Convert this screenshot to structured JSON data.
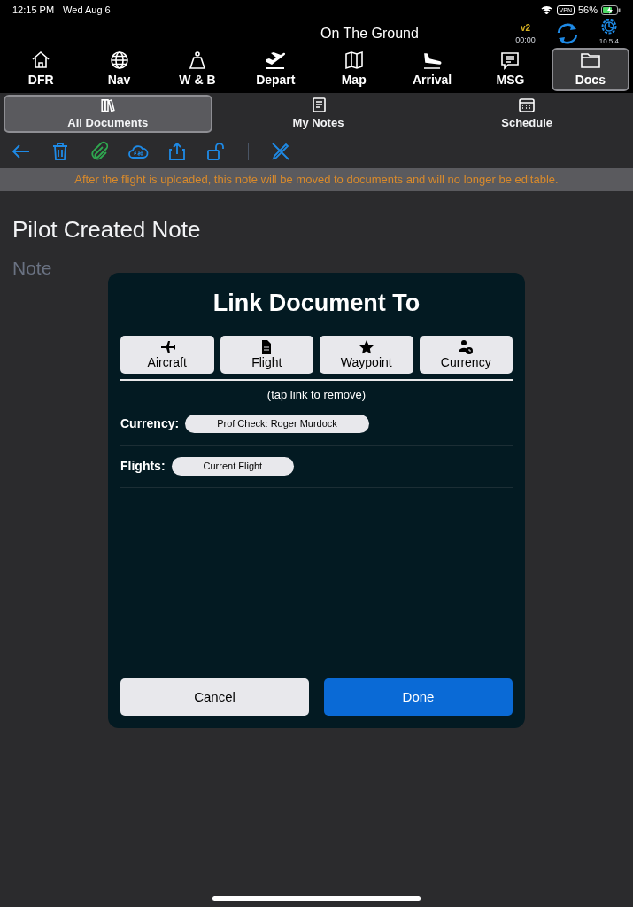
{
  "status_bar": {
    "time": "12:15 PM",
    "date": "Wed Aug 6",
    "vpn": "VPN",
    "battery": "56%"
  },
  "header": {
    "title": "On The Ground",
    "version": "v2",
    "timer": "00:00",
    "build": "10.5.4"
  },
  "nav_tabs": [
    {
      "label": "DFR",
      "selected": false
    },
    {
      "label": "Nav",
      "selected": false
    },
    {
      "label": "W & B",
      "selected": false
    },
    {
      "label": "Depart",
      "selected": false
    },
    {
      "label": "Map",
      "selected": false
    },
    {
      "label": "Arrival",
      "selected": false
    },
    {
      "label": "MSG",
      "selected": false
    },
    {
      "label": "Docs",
      "selected": true
    }
  ],
  "sub_tabs": [
    {
      "label": "All Documents",
      "selected": true
    },
    {
      "label": "My Notes",
      "selected": false
    },
    {
      "label": "Schedule",
      "selected": false
    }
  ],
  "banner": "After the flight is uploaded, this note will be moved to documents and will no longer be editable.",
  "note": {
    "title": "Pilot Created Note",
    "placeholder": "Note"
  },
  "dialog": {
    "title": "Link Document To",
    "link_buttons": [
      {
        "label": "Aircraft"
      },
      {
        "label": "Flight"
      },
      {
        "label": "Waypoint"
      },
      {
        "label": "Currency"
      }
    ],
    "hint": "(tap link to remove)",
    "links": [
      {
        "label": "Currency:",
        "chip": "Prof Check: Roger Murdock"
      },
      {
        "label": "Flights:",
        "chip": "Current Flight"
      }
    ],
    "buttons": [
      {
        "label": "Cancel",
        "kind": "secondary"
      },
      {
        "label": "Done",
        "kind": "primary"
      }
    ]
  }
}
